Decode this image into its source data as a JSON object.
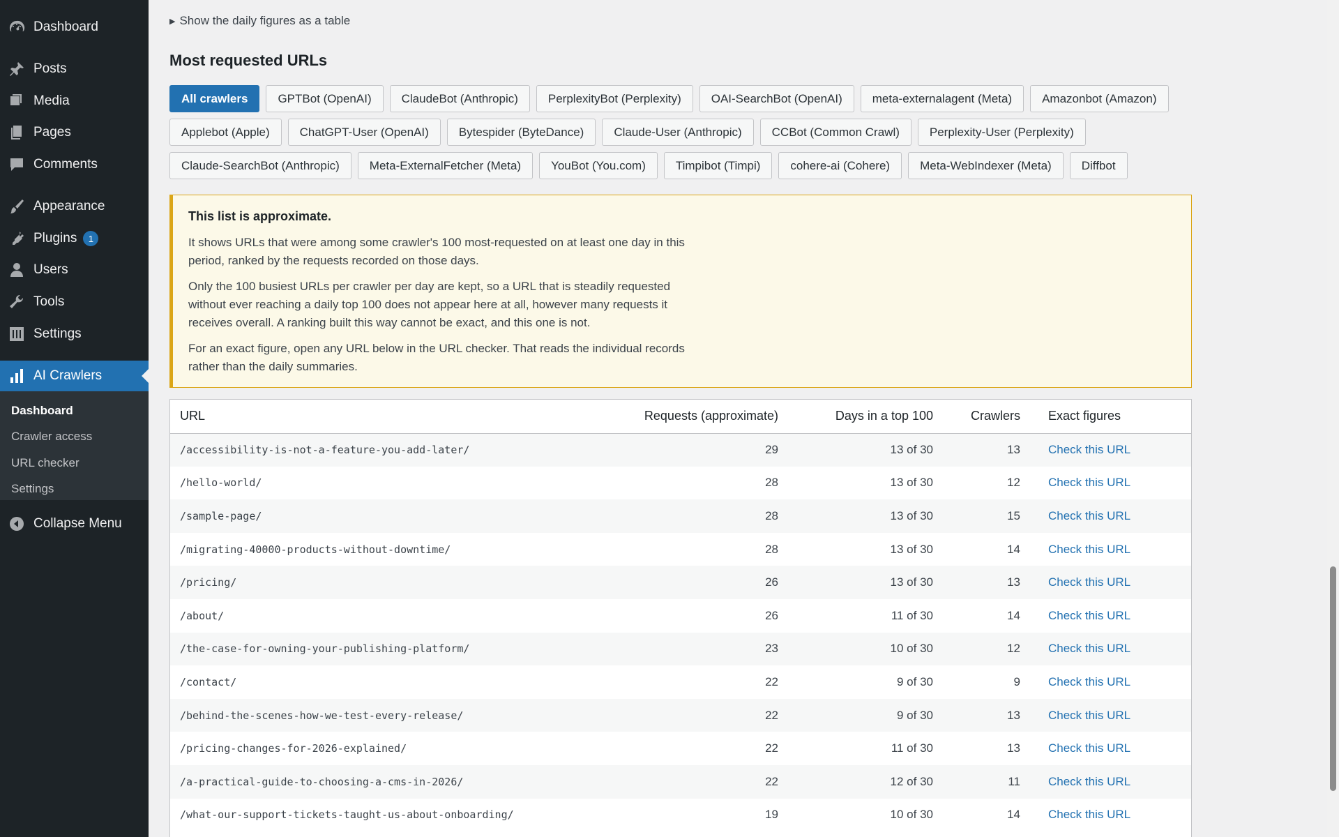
{
  "sidebar": {
    "items": [
      {
        "label": "Dashboard",
        "icon": "dashboard-icon"
      },
      {
        "label": "Posts",
        "icon": "pin-icon"
      },
      {
        "label": "Media",
        "icon": "media-icon"
      },
      {
        "label": "Pages",
        "icon": "pages-icon"
      },
      {
        "label": "Comments",
        "icon": "comment-icon"
      },
      {
        "label": "Appearance",
        "icon": "brush-icon"
      },
      {
        "label": "Plugins",
        "icon": "plug-icon",
        "badge": "1"
      },
      {
        "label": "Users",
        "icon": "user-icon"
      },
      {
        "label": "Tools",
        "icon": "wrench-icon"
      },
      {
        "label": "Settings",
        "icon": "sliders-icon"
      },
      {
        "label": "AI Crawlers",
        "icon": "bar-chart-icon"
      }
    ],
    "submenu": [
      "Dashboard",
      "Crawler access",
      "URL checker",
      "Settings"
    ],
    "collapse_label": "Collapse Menu"
  },
  "main": {
    "details_toggle": "Show the daily figures as a table",
    "title": "Most requested URLs",
    "filters": [
      [
        "All crawlers",
        "GPTBot (OpenAI)",
        "ClaudeBot (Anthropic)",
        "PerplexityBot (Perplexity)",
        "OAI-SearchBot (OpenAI)",
        "meta-externalagent (Meta)",
        "Amazonbot (Amazon)"
      ],
      [
        "Applebot (Apple)",
        "ChatGPT-User (OpenAI)",
        "Bytespider (ByteDance)",
        "Claude-User (Anthropic)",
        "CCBot (Common Crawl)",
        "Perplexity-User (Perplexity)"
      ],
      [
        "Claude-SearchBot (Anthropic)",
        "Meta-ExternalFetcher (Meta)",
        "YouBot (You.com)",
        "Timpibot (Timpi)",
        "cohere-ai (Cohere)",
        "Meta-WebIndexer (Meta)",
        "Diffbot"
      ]
    ],
    "active_filter": "All crawlers",
    "notice": {
      "heading": "This list is approximate.",
      "paragraphs": [
        "It shows URLs that were among some crawler's 100 most-requested on at least one day in this period, ranked by the requests recorded on those days.",
        "Only the 100 busiest URLs per crawler per day are kept, so a URL that is steadily requested without ever reaching a daily top 100 does not appear here at all, however many requests it receives overall. A ranking built this way cannot be exact, and this one is not.",
        "For an exact figure, open any URL below in the URL checker. That reads the individual records rather than the daily summaries."
      ]
    },
    "table": {
      "headers": {
        "url": "URL",
        "requests": "Requests (approximate)",
        "days": "Days in a top 100",
        "crawlers": "Crawlers",
        "exact": "Exact figures"
      },
      "link_label": "Check this URL",
      "rows": [
        {
          "url": "/accessibility-is-not-a-feature-you-add-later/",
          "requests": "29",
          "days": "13 of 30",
          "crawlers": "13"
        },
        {
          "url": "/hello-world/",
          "requests": "28",
          "days": "13 of 30",
          "crawlers": "12"
        },
        {
          "url": "/sample-page/",
          "requests": "28",
          "days": "13 of 30",
          "crawlers": "15"
        },
        {
          "url": "/migrating-40000-products-without-downtime/",
          "requests": "28",
          "days": "13 of 30",
          "crawlers": "14"
        },
        {
          "url": "/pricing/",
          "requests": "26",
          "days": "13 of 30",
          "crawlers": "13"
        },
        {
          "url": "/about/",
          "requests": "26",
          "days": "11 of 30",
          "crawlers": "14"
        },
        {
          "url": "/the-case-for-owning-your-publishing-platform/",
          "requests": "23",
          "days": "10 of 30",
          "crawlers": "12"
        },
        {
          "url": "/contact/",
          "requests": "22",
          "days": "9 of 30",
          "crawlers": "9"
        },
        {
          "url": "/behind-the-scenes-how-we-test-every-release/",
          "requests": "22",
          "days": "9 of 30",
          "crawlers": "13"
        },
        {
          "url": "/pricing-changes-for-2026-explained/",
          "requests": "22",
          "days": "11 of 30",
          "crawlers": "13"
        },
        {
          "url": "/a-practical-guide-to-choosing-a-cms-in-2026/",
          "requests": "22",
          "days": "12 of 30",
          "crawlers": "11"
        },
        {
          "url": "/what-our-support-tickets-taught-us-about-onboarding/",
          "requests": "19",
          "days": "10 of 30",
          "crawlers": "14"
        }
      ]
    }
  },
  "colors": {
    "accent": "#2271b1",
    "sidebar": "#1d2327",
    "notice_border": "#dba617",
    "notice_bg": "#fcf9e8"
  }
}
